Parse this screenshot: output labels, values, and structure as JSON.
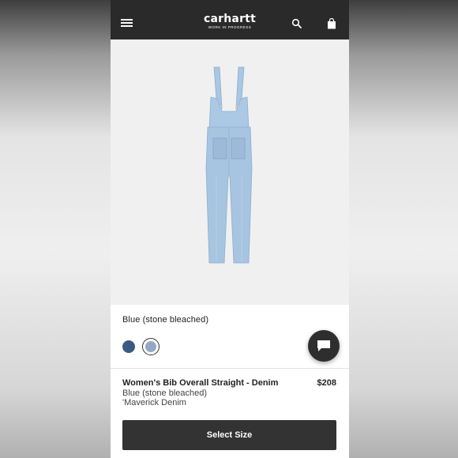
{
  "header": {
    "brand": "carhartt",
    "tagline": "WORK IN PROGRESS",
    "icons": [
      "menu-icon",
      "search-icon",
      "shopping-bag-icon"
    ]
  },
  "product": {
    "selected_color_label": "Blue (stone bleached)",
    "swatches": [
      {
        "name": "dark-blue",
        "color": "#3a5a82",
        "selected": false
      },
      {
        "name": "stone-bleached-blue",
        "color": "#93a9c8",
        "selected": true
      }
    ],
    "name": "Women's Bib Overall Straight - Denim",
    "price": "$208",
    "color": "Blue (stone bleached)",
    "fabric": "'Maverick Denim"
  },
  "actions": {
    "select_size_label": "Select Size",
    "chat_icon": "chat-bubble-icon"
  },
  "colors": {
    "topbar": "#2a2a2a",
    "button": "#333333",
    "denim": "#a9c6e3"
  }
}
